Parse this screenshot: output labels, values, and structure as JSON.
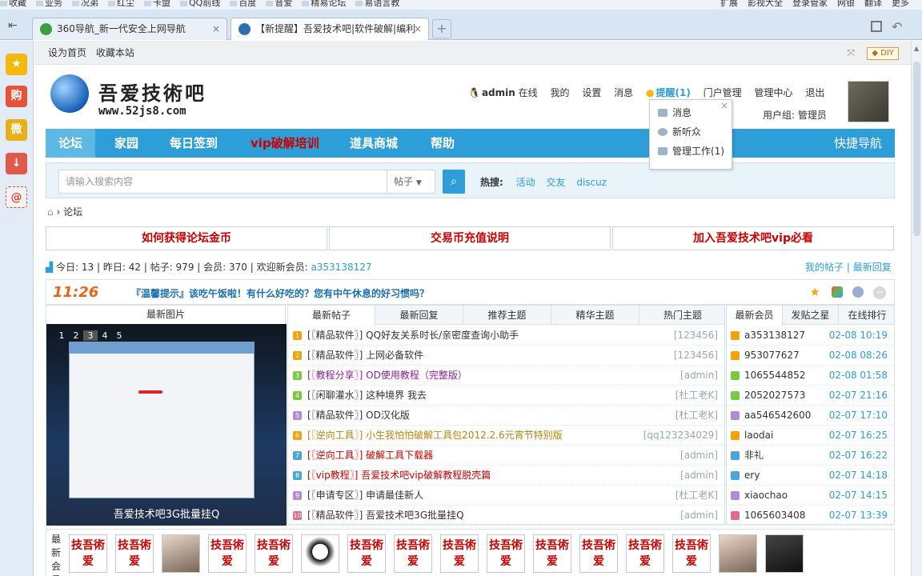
{
  "bookmarks": [
    "收藏",
    "业务",
    "况弟",
    "红尘",
    "卡盟",
    "QQ前线",
    "百度",
    "音爱",
    "精易论坛",
    "易语言教"
  ],
  "bookmarks_right": [
    "扩展",
    "影视大全",
    "登录管家",
    "网银",
    "翻译",
    "更多"
  ],
  "tabs": [
    {
      "title": "360导航_新一代安全上网导航",
      "active": false
    },
    {
      "title": "【新提醒】吾爱技术吧|软件破解|编利",
      "active": true
    }
  ],
  "sidebar_icons": [
    "star-icon",
    "cart-icon",
    "weibo-icon",
    "download-icon",
    "email-icon"
  ],
  "topbar": {
    "set_home": "设为首页",
    "bookmark": "收藏本站",
    "diy": "DIY"
  },
  "logo": {
    "name": "吾爱技術吧",
    "url": "www.52js8.com"
  },
  "usernav": {
    "user": "admin",
    "status": "在线",
    "mine": "我的",
    "settings": "设置",
    "messages": "消息",
    "alerts": "提醒(1)",
    "portal": "门户管理",
    "admin_center": "管理中心",
    "logout": "退出",
    "group": "用户组: 管理员"
  },
  "popup": {
    "items": [
      "消息",
      "新听众",
      "管理工作(1)"
    ]
  },
  "mainnav": {
    "items": [
      "论坛",
      "家园",
      "每日签到",
      "vip破解培训",
      "道具商城",
      "帮助"
    ],
    "quick": "快捷导航"
  },
  "search": {
    "placeholder": "请输入搜索内容",
    "type": "帖子",
    "hot_label": "热搜:",
    "hot": [
      "活动",
      "交友",
      "discuz"
    ]
  },
  "breadcrumb": "论坛",
  "banners": [
    "如何获得论坛金币",
    "交易币充值说明",
    "加入吾爱技术吧vip必看"
  ],
  "stats": {
    "today": "今日: 13",
    "yesterday": "昨日: 42",
    "posts": "帖子: 979",
    "members": "会员: 370",
    "welcome": "欢迎新会员:",
    "new_member": "a353138127",
    "my_posts": "我的帖子",
    "latest_reply": "最新回复"
  },
  "tip": {
    "clock": "11:26",
    "text": "『温馨提示』该吃午饭啦！有什么好吃的？您有中午休息的好习惯吗？"
  },
  "pics": {
    "header": "最新图片",
    "nums": [
      "1",
      "2",
      "3",
      "4",
      "5"
    ],
    "caption": "吾爱技术吧3G批量挂Q"
  },
  "post_tabs": [
    "最新帖子",
    "最新回复",
    "推荐主题",
    "精华主题",
    "热门主题"
  ],
  "posts": [
    {
      "title": "[〖精品软件〗] QQ好友关系时长/亲密度查询小助手",
      "author": "[123456]",
      "color": "#333"
    },
    {
      "title": "[〖精品软件〗] 上网必备软件",
      "author": "[123456]",
      "color": "#333"
    },
    {
      "title": "[〖教程分享〗] OD使用教程（完整版）",
      "author": "[admin]",
      "color": "#8a1fa0"
    },
    {
      "title": "[〖闲聊灌水〗] 这种境界  我去",
      "author": "[杜工老K]",
      "color": "#333"
    },
    {
      "title": "[〖精品软件〗] OD汉化版",
      "author": "[杜工老K]",
      "color": "#333"
    },
    {
      "title": "[〖逆向工具〗] 小生我怕怕破解工具包2012.2.6元宵节特别版",
      "author": "[qq123234029]",
      "color": "#b8860b"
    },
    {
      "title": "[〖逆向工具〗] 破解工具下载器",
      "author": "[admin]",
      "color": "#c00"
    },
    {
      "title": "[〖vip教程〗] 吾爱技术吧vip破解教程脱壳篇",
      "author": "[admin]",
      "color": "#c00"
    },
    {
      "title": "[〖申请专区〗] 申请最佳新人",
      "author": "[杜工老K]",
      "color": "#333"
    },
    {
      "title": "[〖精品软件〗] 吾爱技术吧3G批量挂Q",
      "author": "[admin]",
      "color": "#333"
    }
  ],
  "member_tabs": [
    "最新会员",
    "发贴之星",
    "在线排行"
  ],
  "members": [
    {
      "name": "a353138127",
      "time": "02-08 10:19"
    },
    {
      "name": "953077627",
      "time": "02-08 08:26"
    },
    {
      "name": "1065544852",
      "time": "02-08 01:58"
    },
    {
      "name": "2052027573",
      "time": "02-07 21:16"
    },
    {
      "name": "aa546542600",
      "time": "02-07 17:10"
    },
    {
      "name": "laodai",
      "time": "02-07 16:25"
    },
    {
      "name": "非礼",
      "time": "02-07 16:22"
    },
    {
      "name": "ery",
      "time": "02-07 14:18"
    },
    {
      "name": "xiaochao",
      "time": "02-07 14:15"
    },
    {
      "name": "1065603408",
      "time": "02-07 13:39"
    }
  ],
  "newmem_label": "最新会员",
  "avatar_text": "技吾術爱",
  "colors": {
    "brand": "#2d9ed7",
    "alert": "#c00",
    "orange": "#e8641b"
  }
}
